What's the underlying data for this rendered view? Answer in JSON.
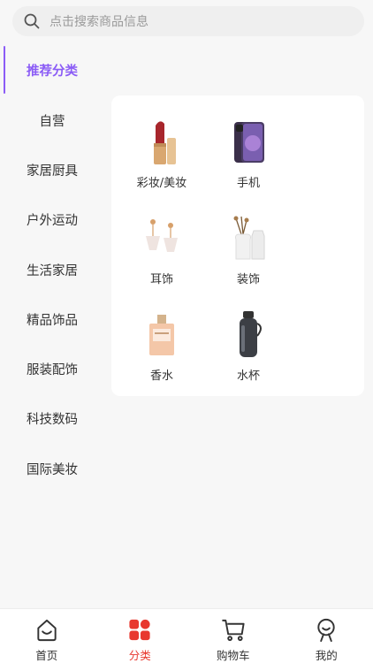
{
  "search": {
    "placeholder": "点击搜索商品信息",
    "icon": "search-icon"
  },
  "sidebar": {
    "active": "推荐分类",
    "items": [
      "自营",
      "家居厨具",
      "户外运动",
      "生活家居",
      "精品饰品",
      "服装配饰",
      "科技数码",
      "国际美妆"
    ]
  },
  "categories": [
    {
      "label": "彩妆/美妆",
      "icon": "lipstick-icon"
    },
    {
      "label": "手机",
      "icon": "phone-icon"
    },
    {
      "label": "耳饰",
      "icon": "earring-icon"
    },
    {
      "label": "装饰",
      "icon": "vase-icon"
    },
    {
      "label": "香水",
      "icon": "perfume-icon"
    },
    {
      "label": "水杯",
      "icon": "bottle-icon"
    }
  ],
  "tabs": [
    {
      "label": "首页",
      "icon": "home-icon"
    },
    {
      "label": "分类",
      "icon": "category-icon"
    },
    {
      "label": "购物车",
      "icon": "cart-icon"
    },
    {
      "label": "我的",
      "icon": "profile-icon"
    }
  ],
  "colors": {
    "accent": "#8b5cf6",
    "tab_active": "#e8382f"
  }
}
